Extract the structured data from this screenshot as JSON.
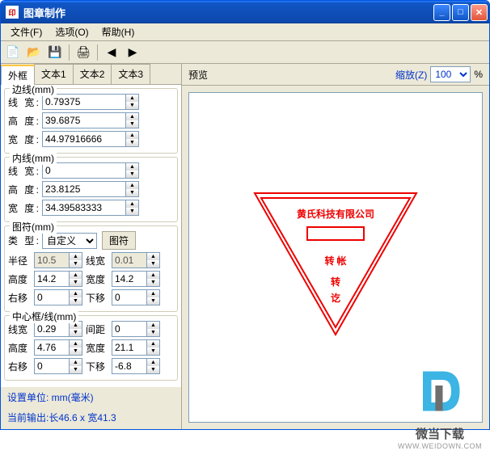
{
  "window": {
    "title": "图章制作"
  },
  "menu": {
    "file": "文件(F)",
    "options": "选项(O)",
    "help": "帮助(H)"
  },
  "tabs": {
    "t1": "外框",
    "t2": "文本1",
    "t3": "文本2",
    "t4": "文本3"
  },
  "groups": {
    "edge": "边线(mm)",
    "inner": "内线(mm)",
    "symbol": "图符(mm)",
    "center": "中心框/线(mm)"
  },
  "labels": {
    "lineWidth": "线  宽:",
    "height": "高  度:",
    "width": "宽  度:",
    "type": "类  型:",
    "radius": "半径",
    "lw2": "线宽",
    "h2": "高度",
    "w2": "宽度",
    "right": "右移",
    "down": "下移",
    "gap": "间距",
    "symbolBtn": "图符"
  },
  "values": {
    "edge_lw": "0.79375",
    "edge_h": "39.6875",
    "edge_w": "44.97916666",
    "inner_lw": "0",
    "inner_h": "23.8125",
    "inner_w": "34.39583333",
    "sym_type": "自定义",
    "sym_radius": "10.5",
    "sym_lw": "0.01",
    "sym_h": "14.2",
    "sym_w": "14.2",
    "sym_right": "0",
    "sym_down": "0",
    "cen_lw": "0.29",
    "cen_gap": "0",
    "cen_h": "4.76",
    "cen_w": "21.1",
    "cen_right": "0",
    "cen_down": "-6.8"
  },
  "info": {
    "unit": "设置单位: mm(毫米)",
    "output": "当前输出:长46.6 x 宽41.3"
  },
  "preview": {
    "label": "预览",
    "zoomLabel": "缩放(Z)",
    "zoomValue": "100",
    "percent": "%"
  },
  "stamp": {
    "line1": "黄氏科技有限公司",
    "line2": "转 帐",
    "line3": "转",
    "line4": "讫"
  },
  "watermark": {
    "text": "微当下载",
    "url": "WWW.WEIDOWN.COM"
  }
}
